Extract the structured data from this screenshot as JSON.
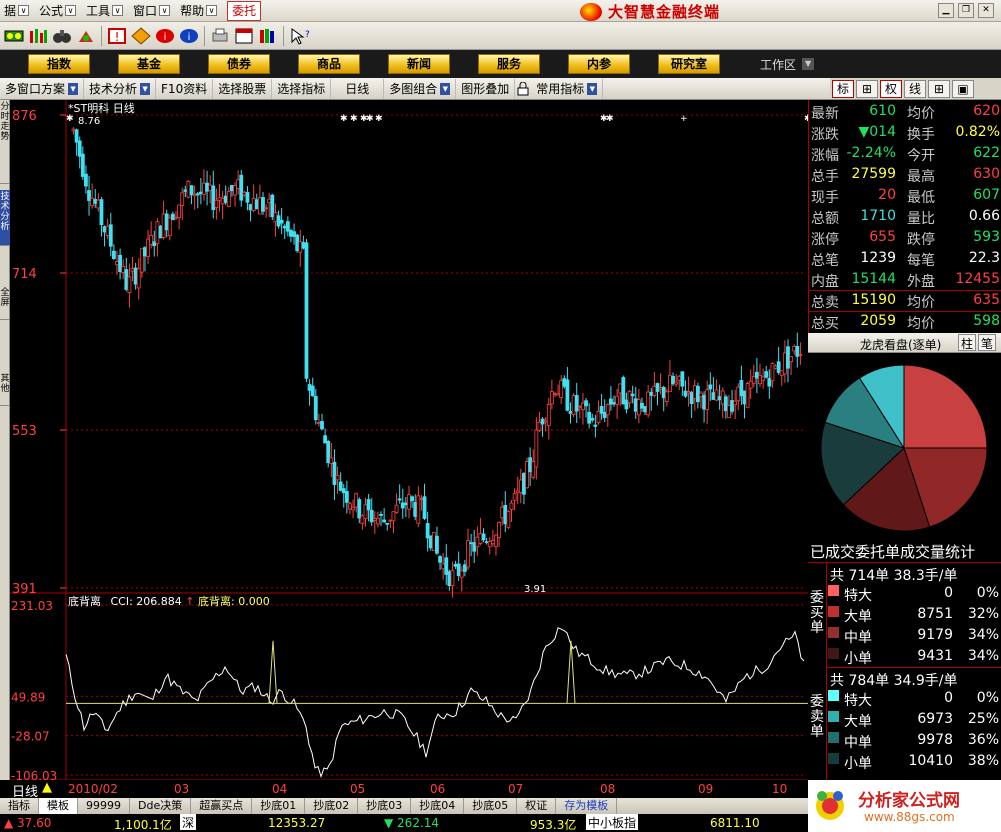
{
  "menu": {
    "items": [
      "据",
      "公式",
      "工具",
      "窗口",
      "帮助"
    ],
    "active": "委托",
    "brand": "大智慧金融终端"
  },
  "nav": {
    "buttons": [
      "指数",
      "基金",
      "债券",
      "商品",
      "新闻",
      "服务",
      "内参",
      "研究室"
    ],
    "workspace": "工作区"
  },
  "funcbar": {
    "items": [
      "多窗口方案",
      "技术分析",
      "F10资料",
      "选择股票",
      "选择指标",
      "日线",
      "多图组合",
      "图形叠加",
      "常用指标"
    ],
    "arrows": [
      true,
      true,
      false,
      false,
      false,
      false,
      true,
      false,
      true
    ]
  },
  "right_tabs": [
    "标",
    "⊞",
    "权",
    "线",
    "⊞",
    "▣"
  ],
  "left_tabs": [
    "分时走势",
    "技术分析",
    "全屏",
    "其他"
  ],
  "chart": {
    "title": "*ST明科 日线",
    "high_label": "8.76",
    "low_label": "3.91",
    "price_ticks": [
      "876",
      "714",
      "553",
      "391"
    ],
    "indicator_header_a": "底背离",
    "indicator_header_b": "CCI: 206.884",
    "indicator_header_c": "底背离: 0.000",
    "indicator_ticks": [
      "231.03",
      "49.89",
      "-28.07",
      "-106.03"
    ],
    "date_labels": [
      "2010/02",
      "03",
      "04",
      "05",
      "06",
      "07",
      "08",
      "09",
      "10"
    ],
    "period": "日线"
  },
  "chart_data": {
    "type": "candlestick",
    "title": "*ST明科 日线",
    "ylim": [
      391,
      876
    ],
    "indicator": "CCI",
    "indicator_value": 206.884,
    "indicator_ylim": [
      -106.03,
      231.03
    ],
    "x": [
      "2010/02",
      "03",
      "04",
      "05",
      "06",
      "07",
      "08",
      "09",
      "10"
    ],
    "high": 8.76,
    "low": 3.91
  },
  "quote": {
    "rows": [
      {
        "l1": "最新",
        "v1": "610",
        "c1": "green",
        "l2": "均价",
        "v2": "620",
        "c2": "red"
      },
      {
        "l1": "涨跌",
        "v1": "▼014",
        "c1": "green",
        "l2": "换手",
        "v2": "0.82%",
        "c2": "yellow"
      },
      {
        "l1": "涨幅",
        "v1": "-2.24%",
        "c1": "green",
        "l2": "今开",
        "v2": "622",
        "c2": "green"
      },
      {
        "l1": "总手",
        "v1": "27599",
        "c1": "yellow",
        "l2": "最高",
        "v2": "630",
        "c2": "red"
      },
      {
        "l1": "现手",
        "v1": "20",
        "c1": "red",
        "l2": "最低",
        "v2": "607",
        "c2": "green"
      },
      {
        "l1": "总额",
        "v1": "1710",
        "c1": "cyan",
        "l2": "量比",
        "v2": "0.66",
        "c2": "white"
      },
      {
        "l1": "涨停",
        "v1": "655",
        "c1": "red",
        "l2": "跌停",
        "v2": "593",
        "c2": "green"
      },
      {
        "l1": "总笔",
        "v1": "1239",
        "c1": "white",
        "l2": "每笔",
        "v2": "22.3",
        "c2": "white"
      },
      {
        "l1": "内盘",
        "v1": "15144",
        "c1": "green",
        "l2": "外盘",
        "v2": "12455",
        "c2": "red"
      },
      {
        "l1": "总卖",
        "v1": "15190",
        "c1": "yellow",
        "l2": "均价",
        "v2": "635",
        "c2": "red"
      },
      {
        "l1": "总买",
        "v1": "2059",
        "c1": "yellow",
        "l2": "均价",
        "v2": "598",
        "c2": "green"
      }
    ]
  },
  "lhkp": {
    "title": "龙虎看盘(逐单)",
    "tab1": "柱",
    "tab2": "笔"
  },
  "pie": {
    "slices": [
      {
        "value": 25,
        "color": "#c84040"
      },
      {
        "value": 20,
        "color": "#902828"
      },
      {
        "value": 18,
        "color": "#601818"
      },
      {
        "value": 17,
        "color": "#1a3c3c"
      },
      {
        "value": 11,
        "color": "#2a8080"
      },
      {
        "value": 9,
        "color": "#40c0c8"
      }
    ]
  },
  "stats": {
    "title": "已成交委托单成交量统计",
    "buy": {
      "side": "委买单",
      "total": "共 714单 38.3手/单",
      "rows": [
        {
          "name": "特大",
          "count": "0",
          "pct": "0%",
          "color": "#ff6060"
        },
        {
          "name": "大单",
          "count": "8751",
          "pct": "32%",
          "color": "#c03030"
        },
        {
          "name": "中单",
          "count": "9179",
          "pct": "34%",
          "color": "#903030"
        },
        {
          "name": "小单",
          "count": "9431",
          "pct": "34%",
          "color": "#401818"
        }
      ]
    },
    "sell": {
      "side": "委卖单",
      "total": "共 784单 34.9手/单",
      "rows": [
        {
          "name": "特大",
          "count": "0",
          "pct": "0%",
          "color": "#60ffff"
        },
        {
          "name": "大单",
          "count": "6973",
          "pct": "25%",
          "color": "#30b0b0"
        },
        {
          "name": "中单",
          "count": "9978",
          "pct": "36%",
          "color": "#207070"
        },
        {
          "name": "小单",
          "count": "10410",
          "pct": "38%",
          "color": "#143c3c"
        }
      ]
    }
  },
  "bottom_tabs": [
    "指标",
    "模板",
    "99999",
    "Dde决策",
    "超赢买点",
    "抄底01",
    "抄底02",
    "抄底03",
    "抄底04",
    "抄底05",
    "权证",
    "存为模板"
  ],
  "status": {
    "a": "▲ 37.60",
    "b": "1,100.1亿",
    "c": "深",
    "d": "12353.27",
    "e": "▼ 262.14",
    "f": "953.3亿",
    "g": "中小板指",
    "h": "6811.10"
  },
  "watermark": {
    "text": "分析家公式网",
    "url": "www.88gs.com"
  }
}
